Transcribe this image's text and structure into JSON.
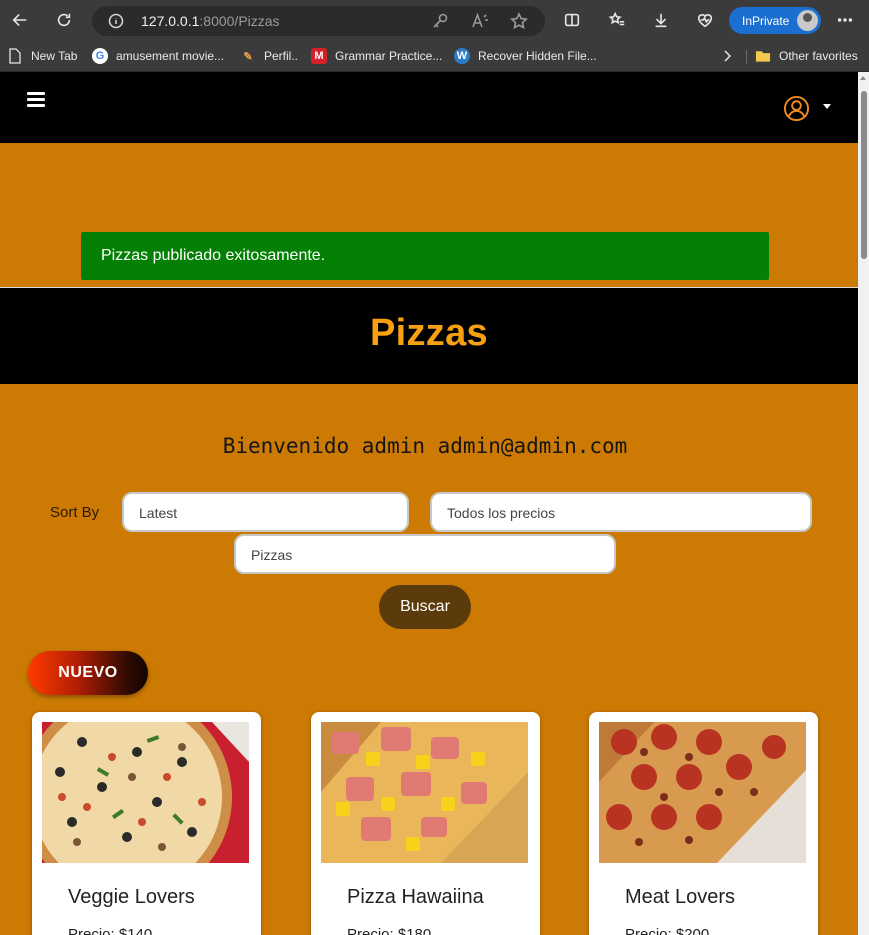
{
  "browser": {
    "url_host": "127.0.0.1",
    "url_path": ":8000/Pizzas",
    "inprivate_label": "InPrivate",
    "bookmarks": [
      {
        "label": "New Tab",
        "icon": "page-icon"
      },
      {
        "label": "amusement movie...",
        "icon": "google-icon"
      },
      {
        "label": "Perfil..",
        "icon": "pen-icon"
      },
      {
        "label": "Grammar Practice...",
        "icon": "m-icon"
      },
      {
        "label": "Recover Hidden File...",
        "icon": "wordpress-icon"
      }
    ],
    "other_favorites": "Other favorites"
  },
  "alert": {
    "message": "Pizzas publicado exitosamente.",
    "color": "#048104"
  },
  "page": {
    "title": "Pizzas",
    "welcome": "Bienvenido admin admin@admin.com"
  },
  "filters": {
    "sort_label": "Sort By",
    "sort_value": "Latest",
    "price_value": "Todos los precios",
    "category_value": "Pizzas",
    "search_button": "Buscar"
  },
  "badge": "NUEVO",
  "products": [
    {
      "name": "Veggie Lovers",
      "price": "Precio: $140"
    },
    {
      "name": "Pizza Hawaiina",
      "price": "Precio: $180"
    },
    {
      "name": "Meat Lovers",
      "price": "Precio: $200"
    }
  ],
  "colors": {
    "page_bg": "#cc7a04",
    "title": "#f9a012",
    "button": "#5b3a0c"
  }
}
